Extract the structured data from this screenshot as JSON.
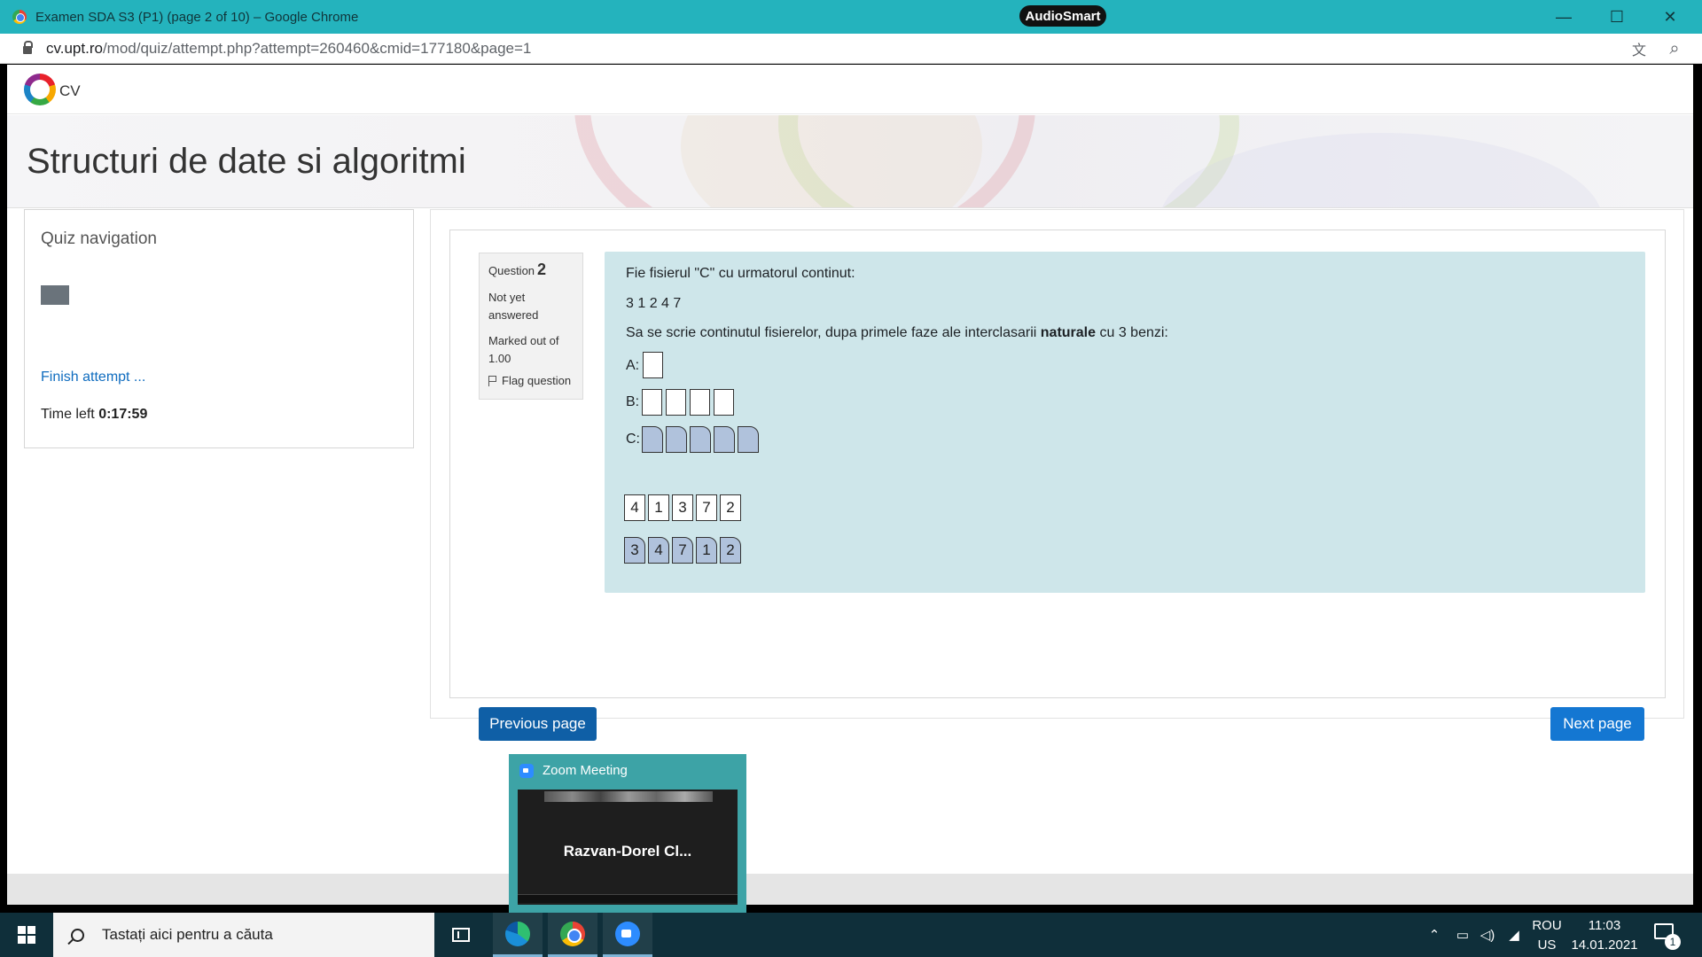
{
  "window": {
    "title": "Examen SDA S3 (P1) (page 2 of 10) – Google Chrome",
    "badge": "AudioSmart",
    "minimize_icon": "minimize-icon",
    "maximize_icon": "maximize-icon",
    "close_icon": "close-icon",
    "minimize_glyph": "—",
    "maximize_glyph": "☐",
    "close_glyph": "✕"
  },
  "address_bar": {
    "host": "cv.upt.ro",
    "path": "/mod/quiz/attempt.php?attempt=260460&cmid=177180&page=1",
    "translate_glyph": "文",
    "zoom_glyph": "⌕"
  },
  "site": {
    "logo_text": "CV",
    "course_title": "Structuri de date si algoritmi"
  },
  "quiz_navigation": {
    "title": "Quiz navigation",
    "finish_label": "Finish attempt ...",
    "time_left_label": "Time left",
    "time_left_value": "0:17:59",
    "current_page": 2,
    "total_pages": 10
  },
  "question": {
    "label": "Question",
    "number": "2",
    "state": "Not yet answered",
    "grade": "Marked out of 1.00",
    "flag_label": "Flag question",
    "text_line1": "Fie fisierul \"C\" cu urmatorul continut:",
    "text_line2": "3 1 2 4 7",
    "text_line3_pre": "Sa se scrie continutul fisierelor, dupa primele faze ale interclasarii ",
    "text_line3_bold": "naturale",
    "text_line3_post": " cu 3 benzi:",
    "label_a": "A:",
    "label_b": "B:",
    "label_c": "C:",
    "white_tiles": [
      "4",
      "1",
      "3",
      "7",
      "2"
    ],
    "blue_tiles": [
      "3",
      "4",
      "7",
      "1",
      "2"
    ]
  },
  "buttons": {
    "previous": "Previous page",
    "next": "Next page"
  },
  "zoom_popup": {
    "title": "Zoom Meeting",
    "participant": "Razvan-Dorel  Cl..."
  },
  "taskbar": {
    "search_placeholder": "Tastați aici pentru a căuta",
    "lang_top": "ROU",
    "lang_bottom": "US",
    "time": "11:03",
    "date": "14.01.2021",
    "notification_count": "1"
  }
}
